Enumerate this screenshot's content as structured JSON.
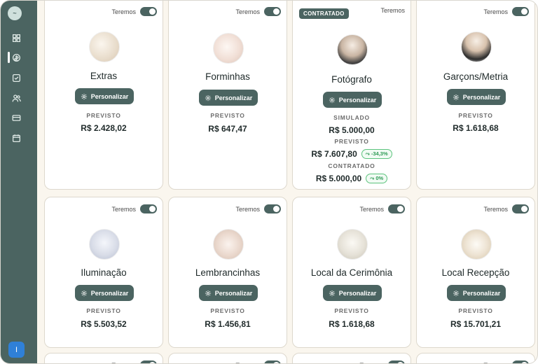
{
  "sidebar": {
    "logo_text": "~",
    "nav_icons": [
      "dashboard-icon",
      "budget-icon",
      "checklist-icon",
      "guests-icon",
      "payment-icon",
      "calendar-icon"
    ],
    "user_initial": "I"
  },
  "toggle_label": "Teremos",
  "customize_label": "Personalizar",
  "labels": {
    "previsto": "PREVISTO",
    "simulado": "SIMULADO",
    "contratado": "CONTRATADO"
  },
  "cards": [
    {
      "name": "Extras",
      "previsto": "R$ 2.428,02"
    },
    {
      "name": "Forminhas",
      "previsto": "R$ 647,47"
    },
    {
      "name": "Fotógrafo",
      "badge": "CONTRATADO",
      "simulado": "R$ 5.000,00",
      "previsto": "R$ 7.607,80",
      "previsto_change": "-34,3%",
      "contratado": "R$ 5.000,00",
      "contratado_change": "0%"
    },
    {
      "name": "Garçons/Metria",
      "previsto": "R$ 1.618,68"
    },
    {
      "name": "Iluminação",
      "previsto": "R$ 5.503,52"
    },
    {
      "name": "Lembrancinhas",
      "previsto": "R$ 1.456,81"
    },
    {
      "name": "Local da Cerimônia",
      "previsto": "R$ 1.618,68"
    },
    {
      "name": "Local Recepção",
      "previsto": "R$ 15.701,21"
    }
  ],
  "colors": {
    "primary": "#4b6461",
    "background": "#faf6ee",
    "positive": "#2e9a55",
    "user_button": "#2f80d8"
  }
}
